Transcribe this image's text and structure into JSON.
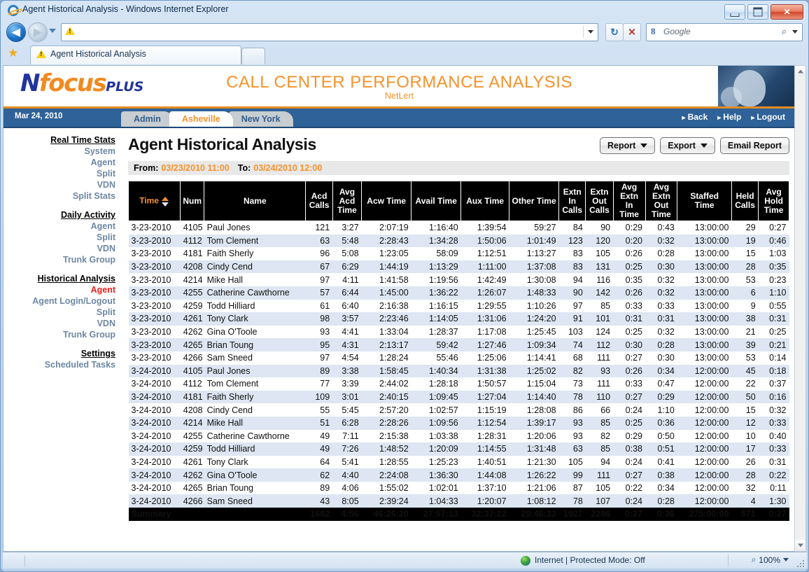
{
  "window": {
    "title": "Agent Historical Analysis - Windows Internet Explorer",
    "minimize_label": "",
    "maximize_label": "",
    "close_label": "✕"
  },
  "browser": {
    "address_value": "",
    "search_placeholder": "Google",
    "search_logo": "8",
    "tab_title": "Agent Historical Analysis",
    "back_glyph": "◀",
    "forward_glyph": "▶",
    "refresh_glyph": "↻",
    "stop_glyph": "✕",
    "magnifier_glyph": "⌕"
  },
  "statusbar": {
    "zone": "Internet | Protected Mode: Off",
    "zoom": "100%",
    "zoom_icon": "⌕"
  },
  "masthead": {
    "logo_n": "N",
    "logo_focus": "focus",
    "logo_plus": "PLUS",
    "title": "CALL CENTER PERFORMANCE ANALYSIS",
    "subtitle": "NetLert"
  },
  "navband": {
    "date": "Mar 24, 2010",
    "tabs": [
      {
        "label": "Admin",
        "active": false
      },
      {
        "label": "Asheville",
        "active": true
      },
      {
        "label": "New York",
        "active": false
      }
    ],
    "links": [
      "Back",
      "Help",
      "Logout"
    ]
  },
  "sidebar": {
    "groups": [
      {
        "heading": "Real Time Stats",
        "items": [
          {
            "label": "System",
            "active": false
          },
          {
            "label": "Agent",
            "active": false
          },
          {
            "label": "Split",
            "active": false
          },
          {
            "label": "VDN",
            "active": false
          },
          {
            "label": "Split Stats",
            "active": false
          }
        ]
      },
      {
        "heading": "Daily Activity",
        "items": [
          {
            "label": "Agent",
            "active": false
          },
          {
            "label": "Split",
            "active": false
          },
          {
            "label": "VDN",
            "active": false
          },
          {
            "label": "Trunk Group",
            "active": false
          }
        ]
      },
      {
        "heading": "Historical Analysis",
        "items": [
          {
            "label": "Agent",
            "active": true
          },
          {
            "label": "Agent Login/Logout",
            "active": false
          },
          {
            "label": "Split",
            "active": false
          },
          {
            "label": "VDN",
            "active": false
          },
          {
            "label": "Trunk Group",
            "active": false
          }
        ]
      },
      {
        "heading": "Settings",
        "items": [
          {
            "label": "Scheduled Tasks",
            "active": false
          }
        ]
      }
    ]
  },
  "main": {
    "page_title": "Agent Historical Analysis",
    "buttons": [
      {
        "label": "Report",
        "caret": true
      },
      {
        "label": "Export",
        "caret": true
      },
      {
        "label": "Email Report",
        "caret": false
      }
    ],
    "date_range": {
      "from_label": "From:",
      "from_value": "03/23/2010 11:00",
      "to_label": "To:",
      "to_value": "03/24/2010 12:00"
    },
    "table": {
      "sort_column": "Time",
      "sort_direction": "asc",
      "columns": [
        "Time",
        "Num",
        "Name",
        "Acd Calls",
        "Avg Acd Time",
        "Acw Time",
        "Avail Time",
        "Aux Time",
        "Other Time",
        "Extn In Calls",
        "Extn Out Calls",
        "Avg Extn In Time",
        "Avg Extn Out Time",
        "Staffed Time",
        "Held Calls",
        "Avg Hold Time"
      ],
      "rows": [
        [
          "3-23-2010",
          "4105",
          "Paul Jones",
          "121",
          "3:27",
          "2:07:19",
          "1:16:40",
          "1:39:54",
          "59:27",
          "84",
          "90",
          "0:29",
          "0:43",
          "13:00:00",
          "29",
          "0:27"
        ],
        [
          "3-23-2010",
          "4112",
          "Tom Clement",
          "63",
          "5:48",
          "2:28:43",
          "1:34:28",
          "1:50:06",
          "1:01:49",
          "123",
          "120",
          "0:20",
          "0:32",
          "13:00:00",
          "19",
          "0:46"
        ],
        [
          "3-23-2010",
          "4181",
          "Faith Sherly",
          "96",
          "5:08",
          "1:23:05",
          "58:09",
          "1:12:51",
          "1:13:27",
          "83",
          "105",
          "0:26",
          "0:28",
          "13:00:00",
          "15",
          "1:03"
        ],
        [
          "3-23-2010",
          "4208",
          "Cindy Cend",
          "67",
          "6:29",
          "1:44:19",
          "1:13:29",
          "1:11:00",
          "1:37:08",
          "83",
          "131",
          "0:25",
          "0:30",
          "13:00:00",
          "28",
          "0:35"
        ],
        [
          "3-23-2010",
          "4214",
          "Mike Hall",
          "97",
          "4:11",
          "1:41:58",
          "1:19:56",
          "1:42:49",
          "1:30:08",
          "94",
          "116",
          "0:35",
          "0:32",
          "13:00:00",
          "53",
          "0:23"
        ],
        [
          "3-23-2010",
          "4255",
          "Catherine Cawthorne",
          "57",
          "6:44",
          "1:45:00",
          "1:36:22",
          "1:26:07",
          "1:48:33",
          "90",
          "142",
          "0:26",
          "0:32",
          "13:00:00",
          "6",
          "1:10"
        ],
        [
          "3-23-2010",
          "4259",
          "Todd Hilliard",
          "61",
          "6:40",
          "2:16:38",
          "1:16:15",
          "1:29:55",
          "1:10:26",
          "97",
          "85",
          "0:33",
          "0:33",
          "13:00:00",
          "9",
          "0:55"
        ],
        [
          "3-23-2010",
          "4261",
          "Tony Clark",
          "98",
          "3:57",
          "2:23:46",
          "1:14:05",
          "1:31:06",
          "1:24:20",
          "91",
          "101",
          "0:31",
          "0:31",
          "13:00:00",
          "38",
          "0:31"
        ],
        [
          "3-23-2010",
          "4262",
          "Gina O'Toole",
          "93",
          "4:41",
          "1:33:04",
          "1:28:37",
          "1:17:08",
          "1:25:45",
          "103",
          "124",
          "0:25",
          "0:32",
          "13:00:00",
          "21",
          "0:25"
        ],
        [
          "3-23-2010",
          "4265",
          "Brian Toung",
          "95",
          "4:31",
          "2:13:17",
          "59:42",
          "1:27:46",
          "1:09:34",
          "74",
          "112",
          "0:30",
          "0:28",
          "13:00:00",
          "39",
          "0:21"
        ],
        [
          "3-23-2010",
          "4266",
          "Sam Sneed",
          "97",
          "4:54",
          "1:28:24",
          "55:46",
          "1:25:06",
          "1:14:41",
          "68",
          "111",
          "0:27",
          "0:30",
          "13:00:00",
          "53",
          "0:14"
        ],
        [
          "3-24-2010",
          "4105",
          "Paul Jones",
          "89",
          "3:38",
          "1:58:45",
          "1:40:34",
          "1:31:38",
          "1:25:02",
          "82",
          "93",
          "0:26",
          "0:34",
          "12:00:00",
          "45",
          "0:18"
        ],
        [
          "3-24-2010",
          "4112",
          "Tom Clement",
          "77",
          "3:39",
          "2:44:02",
          "1:28:18",
          "1:50:57",
          "1:15:04",
          "73",
          "111",
          "0:33",
          "0:47",
          "12:00:00",
          "22",
          "0:37"
        ],
        [
          "3-24-2010",
          "4181",
          "Faith Sherly",
          "109",
          "3:01",
          "2:40:15",
          "1:09:45",
          "1:27:04",
          "1:14:40",
          "78",
          "110",
          "0:27",
          "0:29",
          "12:00:00",
          "50",
          "0:16"
        ],
        [
          "3-24-2010",
          "4208",
          "Cindy Cend",
          "55",
          "5:45",
          "2:57:20",
          "1:02:57",
          "1:15:19",
          "1:28:08",
          "86",
          "66",
          "0:24",
          "1:10",
          "12:00:00",
          "15",
          "0:32"
        ],
        [
          "3-24-2010",
          "4214",
          "Mike Hall",
          "51",
          "6:28",
          "2:28:26",
          "1:09:56",
          "1:12:54",
          "1:39:17",
          "93",
          "85",
          "0:25",
          "0:36",
          "12:00:00",
          "12",
          "0:33"
        ],
        [
          "3-24-2010",
          "4255",
          "Catherine Cawthorne",
          "49",
          "7:11",
          "2:15:38",
          "1:03:38",
          "1:28:31",
          "1:20:06",
          "93",
          "82",
          "0:29",
          "0:50",
          "12:00:00",
          "10",
          "0:40"
        ],
        [
          "3-24-2010",
          "4259",
          "Todd Hilliard",
          "49",
          "7:26",
          "1:48:52",
          "1:20:09",
          "1:14:55",
          "1:31:48",
          "63",
          "85",
          "0:38",
          "0:51",
          "12:00:00",
          "17",
          "0:33"
        ],
        [
          "3-24-2010",
          "4261",
          "Tony Clark",
          "64",
          "5:41",
          "1:28:55",
          "1:25:23",
          "1:40:51",
          "1:21:30",
          "105",
          "94",
          "0:24",
          "0:41",
          "12:00:00",
          "26",
          "0:31"
        ],
        [
          "3-24-2010",
          "4262",
          "Gina O'Toole",
          "62",
          "4:40",
          "2:24:08",
          "1:36:30",
          "1:44:08",
          "1:26:22",
          "99",
          "111",
          "0:27",
          "0:38",
          "12:00:00",
          "28",
          "0:22"
        ],
        [
          "3-24-2010",
          "4265",
          "Brian Toung",
          "89",
          "4:06",
          "1:55:02",
          "1:02:01",
          "1:37:10",
          "1:21:06",
          "87",
          "105",
          "0:22",
          "0:34",
          "12:00:00",
          "32",
          "0:11"
        ],
        [
          "3-24-2010",
          "4266",
          "Sam Sneed",
          "43",
          "8:05",
          "2:39:24",
          "1:04:33",
          "1:20:07",
          "1:08:12",
          "78",
          "107",
          "0:24",
          "0:28",
          "12:00:00",
          "4",
          "1:30"
        ]
      ],
      "summary": [
        "Summary",
        "",
        "",
        "1682",
        "4:56",
        "46:26:20",
        "27:57:13",
        "32:37:22",
        "29:46:33",
        "1927",
        "2286",
        "0:27",
        "0:36",
        "275:00:00",
        "571",
        "0:27"
      ]
    }
  },
  "colors": {
    "accent_orange": "#f5922b",
    "nav_blue": "#2e6298",
    "active_red": "#ee1d1d",
    "sidebar_link": "#6d87a3",
    "row_stripe": "#dde6f2",
    "header_black": "#000000"
  }
}
